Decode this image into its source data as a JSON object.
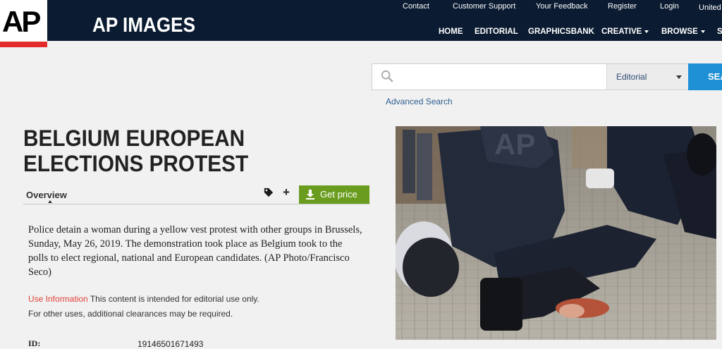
{
  "header": {
    "logo_text": "AP",
    "brand": "AP IMAGES",
    "util_links": [
      "Contact",
      "Customer Support",
      "Your Feedback",
      "Register",
      "Login",
      "United"
    ],
    "main_nav": [
      {
        "label": "HOME"
      },
      {
        "label": "EDITORIAL"
      },
      {
        "label": "GRAPHICSBANK"
      },
      {
        "label": "CREATIVE",
        "dropdown": true
      },
      {
        "label": "BROWSE",
        "dropdown": true
      },
      {
        "label": "S"
      }
    ]
  },
  "search": {
    "placeholder": "",
    "value": "",
    "scope": "Editorial",
    "button_label": "SEA",
    "advanced_label": "Advanced Search"
  },
  "asset": {
    "title": "BELGIUM EUROPEAN ELECTIONS PROTEST",
    "tab_overview": "Overview",
    "get_price_label": "Get price",
    "description": "Police detain a woman during a yellow vest protest with other groups in Brussels, Sunday, May 26, 2019. The demonstration took place as Belgium took to the polls to elect regional, national and European candidates. (AP Photo/Francisco Seco)",
    "use_info_label": "Use Information",
    "use_info_text": "This content is intended for editorial use only.",
    "clearance_text": "For other uses, additional clearances may be required.",
    "id_label": "ID:",
    "id_value": "19146501671493",
    "watermark": "AP"
  },
  "colors": {
    "header_bg": "#0b1b31",
    "logo_red": "#e32b2b",
    "search_button": "#1e90d6",
    "get_price": "#6a9d1f",
    "use_info_red": "#e0433b"
  }
}
